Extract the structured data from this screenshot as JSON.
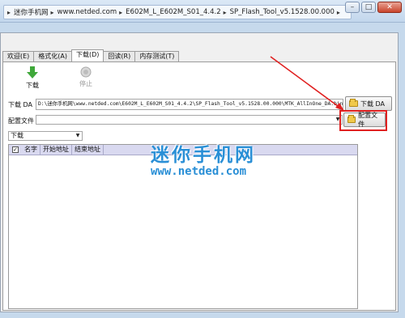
{
  "address_bar": {
    "crumbs": [
      "迷你手机网",
      "www.netded.com",
      "E602M_L_E602M_S01_4.4.2",
      "SP_Flash_Tool_v5.1528.00.000"
    ]
  },
  "window_controls": {
    "minimize": "–",
    "maximize": "□",
    "close": "✕"
  },
  "tabs": [
    {
      "label": "欢迎(E)"
    },
    {
      "label": "格式化(A)"
    },
    {
      "label": "下载(D)",
      "active": true
    },
    {
      "label": "回读(R)"
    },
    {
      "label": "内存测试(T)"
    }
  ],
  "toolbar": {
    "download_label": "下载",
    "stop_label": "停止"
  },
  "download_agent": {
    "label": "下载 DA",
    "path": "D:\\迷你手机网\\www.netded.com\\E602M_L_E602M_S01_4.4.2\\SP_Flash_Tool_v5.1528.00.000\\MTK_AllInOne_DA.bin",
    "button_label": "下载 DA"
  },
  "scatter": {
    "label": "配置文件",
    "value": "",
    "button_label": "配置文件"
  },
  "mode_select": {
    "value": "下载"
  },
  "table": {
    "columns": [
      "名字",
      "开始地址",
      "结束地址"
    ],
    "rows": []
  },
  "watermark": {
    "title": "迷你手机网",
    "url": "www.netded.com"
  },
  "colors": {
    "highlight": "#e02020",
    "watermark": "#2a8fd6",
    "header_bg": "#d9d9f0"
  }
}
